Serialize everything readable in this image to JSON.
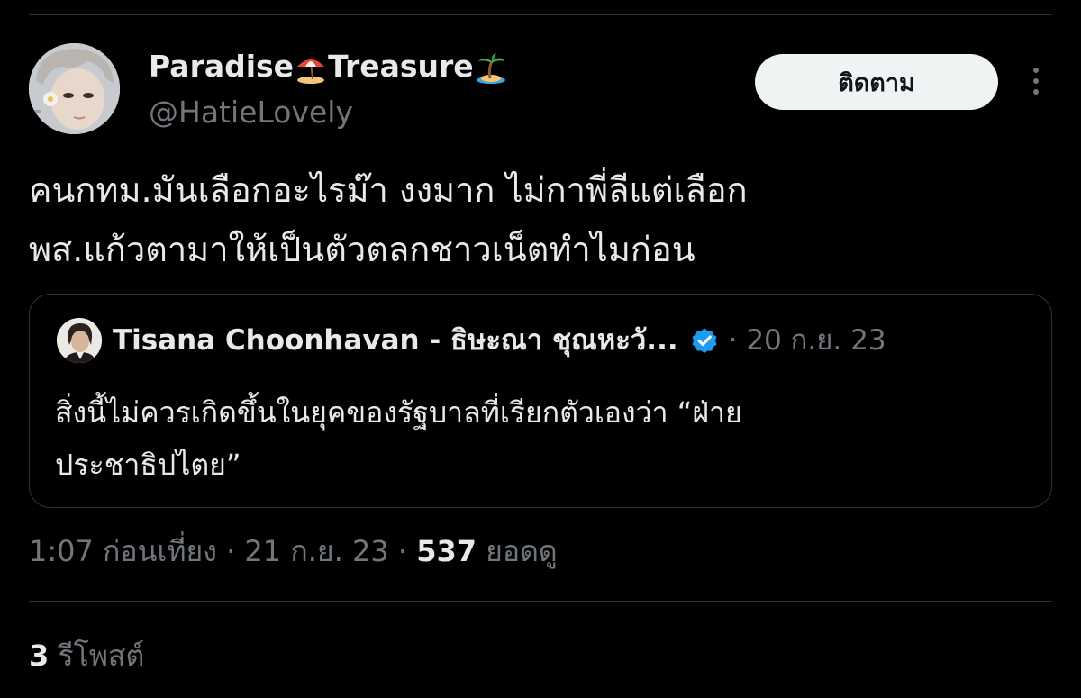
{
  "author": {
    "name_part1": "Paradise",
    "name_part2": "Treasure",
    "handle": "@HatieLovely",
    "follow_label": "ติดตาม"
  },
  "tweet": {
    "text_line1": "คนกทม.มันเลือกอะไรม๊า งงมาก ไม่กาพี่ลีแต่เลือก",
    "text_line2": "พส.แก้วตามาให้เป็นตัวตลกชาวเน็ตทำไมก่อน"
  },
  "quote": {
    "author_name": "Tisana Choonhavan - ธิษะณา ชุณหะวั...",
    "date": "· 20 ก.ย. 23",
    "text_line1": "สิ่งนี้ไม่ควรเกิดขึ้นในยุคของรัฐบาลที่เรียกตัวเองว่า “ฝ่าย",
    "text_line2": "ประชาธิปไตย”"
  },
  "meta": {
    "timestamp": "1:07 ก่อนเที่ยง · 21 ก.ย. 23 · ",
    "views_count": "537",
    "views_label": " ยอดดู"
  },
  "stats": {
    "reposts_count": "3",
    "reposts_label": " รีโพสต์"
  },
  "icons": {
    "name_emoji_1": "beach-umbrella-icon",
    "name_emoji_2": "desert-island-icon",
    "more": "more-vertical-icon",
    "verified": "verified-badge-icon"
  },
  "colors": {
    "background": "#000000",
    "text_primary": "#e7e9ea",
    "text_secondary": "#71767b",
    "border": "#2f3336",
    "follow_button_bg": "#eff3f4",
    "verified_blue": "#1d9bf0"
  }
}
